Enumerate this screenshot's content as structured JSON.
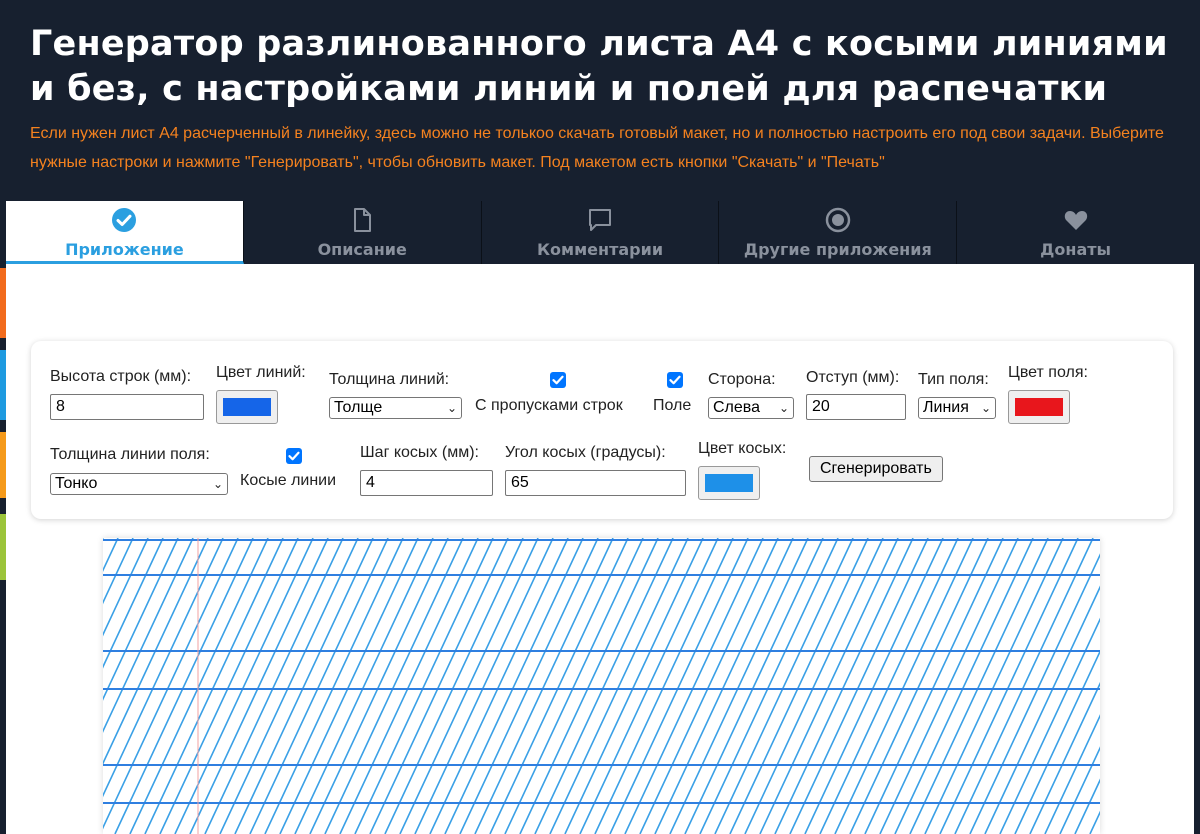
{
  "header": {
    "title": "Генератор разлинованного листа А4 с косыми линиями и без, с настройками линий и полей для распечатки",
    "description": "Если нужен лист А4 расчерченный в линейку, здесь можно не толькоо скачать готовый макет, но и полностью настроить его под свои задачи. Выберите нужные настроки и нажмите \"Генерировать\", чтобы обновить макет. Под макетом есть кнопки \"Скачать\" и \"Печать\""
  },
  "tabs": [
    {
      "label": "Приложение",
      "icon": "check-circle-icon",
      "active": true
    },
    {
      "label": "Описание",
      "icon": "document-icon",
      "active": false
    },
    {
      "label": "Комментарии",
      "icon": "comment-icon",
      "active": false
    },
    {
      "label": "Другие приложения",
      "icon": "target-icon",
      "active": false
    },
    {
      "label": "Донаты",
      "icon": "heart-icon",
      "active": false
    }
  ],
  "settings": {
    "row_height": {
      "label": "Высота строк (мм):",
      "value": "8"
    },
    "line_color": {
      "label": "Цвет линий:",
      "color": "#1565e8"
    },
    "line_thickness": {
      "label": "Толщина линий:",
      "selected": "Толще"
    },
    "skip_rows": {
      "label": "С пропусками строк",
      "checked": true
    },
    "margin": {
      "label": "Поле",
      "checked": true
    },
    "side": {
      "label": "Сторона:",
      "selected": "Слева"
    },
    "offset": {
      "label": "Отступ (мм):",
      "value": "20"
    },
    "margin_type": {
      "label": "Тип поля:",
      "selected": "Линия"
    },
    "margin_color": {
      "label": "Цвет поля:",
      "color": "#e8161c"
    },
    "margin_line_thickness": {
      "label": "Толщина линии поля:",
      "selected": "Тонко"
    },
    "slant_lines": {
      "label": "Косые линии",
      "checked": true
    },
    "slant_step": {
      "label": "Шаг косых (мм):",
      "value": "4"
    },
    "slant_angle": {
      "label": "Угол косых (градусы):",
      "value": "65"
    },
    "slant_color": {
      "label": "Цвет косых:",
      "color": "#1e90e8"
    },
    "generate_button": "Сгенерировать"
  },
  "colors": {
    "accent": "#2b9fe0",
    "header_bg": "#17202f",
    "desc_text": "#f5821f",
    "slant_line": "#3aa0e6",
    "row_line": "#2f7fe0",
    "margin_line": "#f2a0a0"
  }
}
